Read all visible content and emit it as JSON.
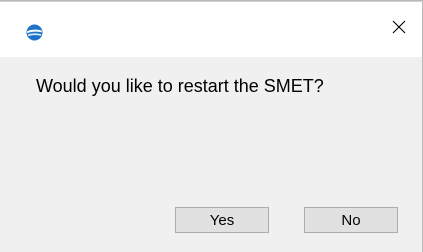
{
  "window": {
    "title": ""
  },
  "titlebar": {
    "app_icon": "app-logo-icon",
    "close_icon": "close-icon",
    "close_glyph": "✕"
  },
  "dialog": {
    "message": "Would you like to restart the SMET?",
    "buttons": {
      "yes_label": "Yes",
      "no_label": "No"
    }
  },
  "colors": {
    "titlebar_bg": "#ffffff",
    "content_bg": "#f0f0f0",
    "button_bg": "#e1e1e1",
    "button_border": "#adadad",
    "icon_blue": "#1e73c8"
  }
}
